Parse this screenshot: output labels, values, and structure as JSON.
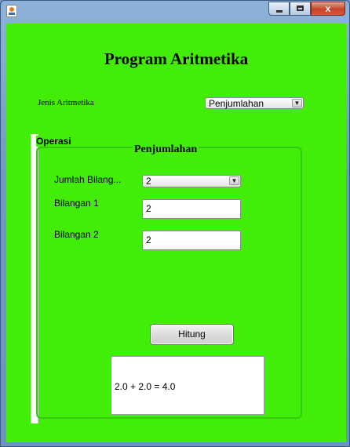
{
  "window": {
    "title": "",
    "minimize": "",
    "maximize": "",
    "close": "x"
  },
  "app": {
    "heading": "Program Aritmetika",
    "jenis_label": "Jenis Aritmetika",
    "jenis_value": "Penjumlahan"
  },
  "operasi": {
    "group_title": "Operasi",
    "panel_title": "Penjumlahan",
    "jumlah_label": "Jumlah Bilang...",
    "jumlah_value": "2",
    "bilangan1_label": "Bilangan 1",
    "bilangan1_value": "2",
    "bilangan2_label": "Bilangan 2",
    "bilangan2_value": "2",
    "hitung_label": "Hitung",
    "result": "2.0 + 2.0 = 4.0"
  },
  "colors": {
    "background": "#42ed08",
    "panel_border": "#35c90e"
  },
  "icons": {
    "app": "java-app-icon",
    "dropdown": "chevron-down-icon"
  }
}
